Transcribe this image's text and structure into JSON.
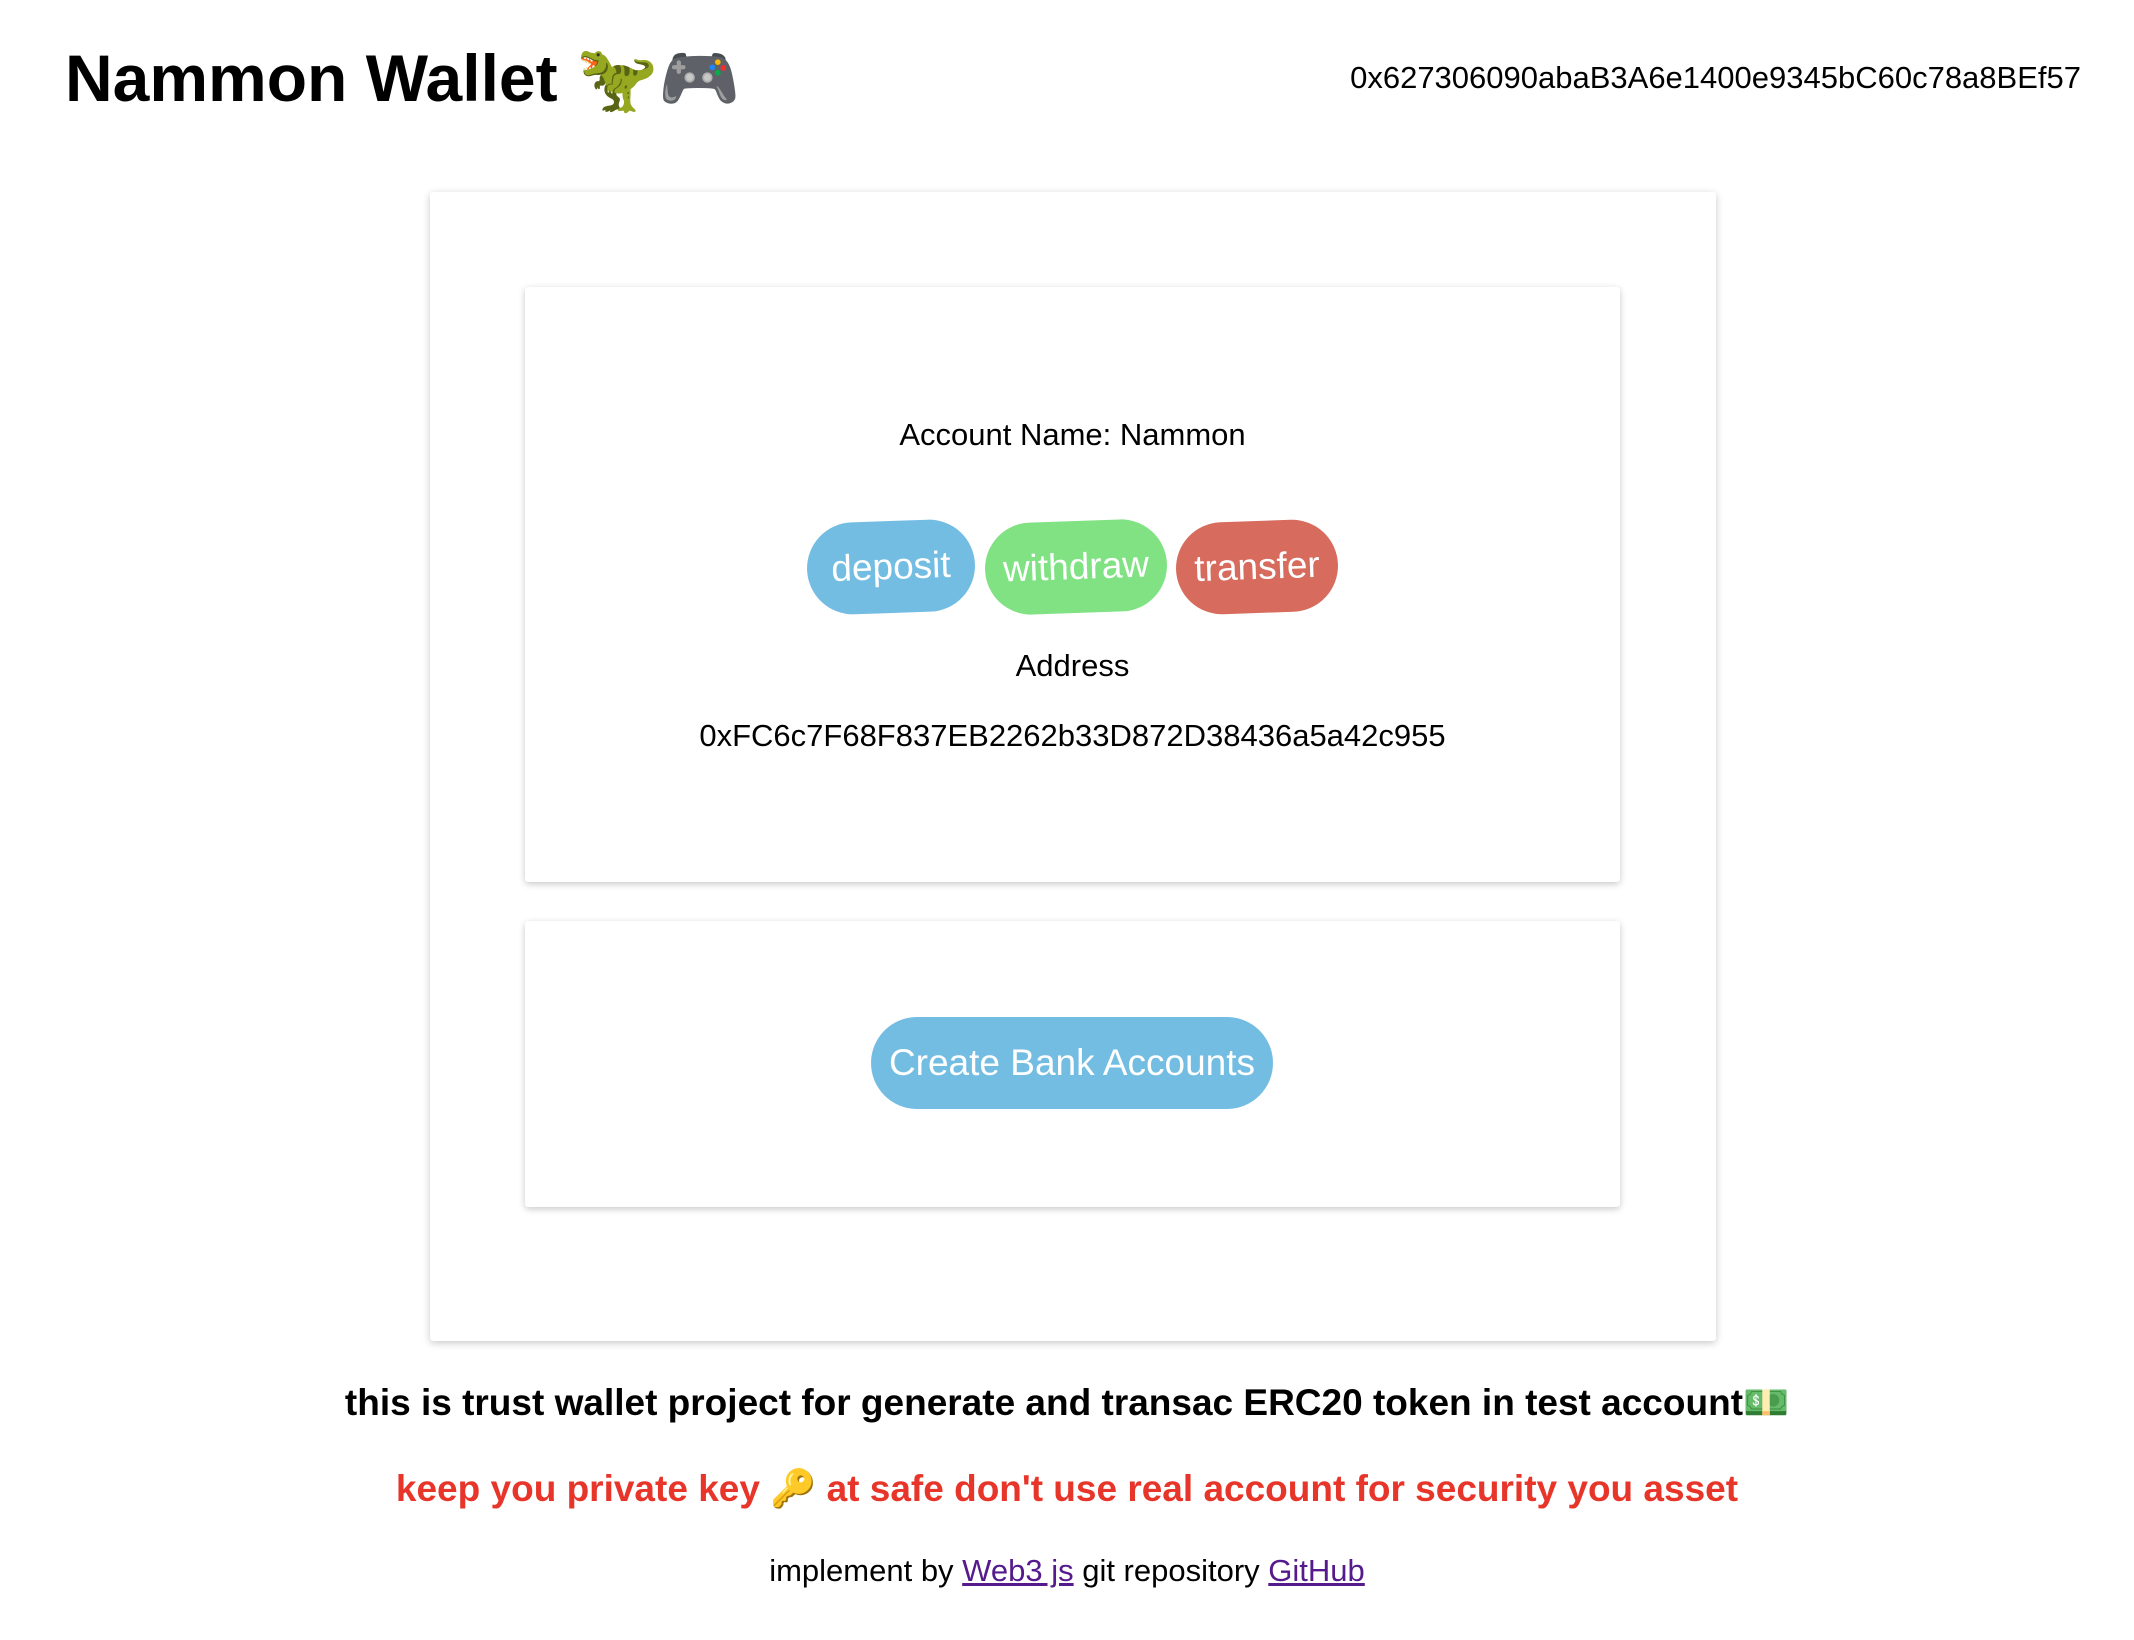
{
  "header": {
    "title": "Nammon Wallet",
    "title_emoji": "🦖🎮",
    "wallet_address": "0x627306090abaB3A6e1400e9345bC60c78a8BEf57"
  },
  "account_card": {
    "account_name": "Account Name: Nammon",
    "buttons": {
      "deposit": "deposit",
      "withdraw": "withdraw",
      "transfer": "transfer"
    },
    "address_label": "Address",
    "address_value": "0xFC6c7F68F837EB2262b33D872D38436a5a42c955"
  },
  "create_card": {
    "create_label": "Create Bank Accounts"
  },
  "footer": {
    "description": "this is trust wallet project for generate and transac ERC20 token in test account💵",
    "warning_before": "keep you private key ",
    "warning_emoji": "🔑",
    "warning_after": " at safe don't use real account for security you asset",
    "implement_prefix": "implement by ",
    "web3_link": "Web3 js",
    "repo_prefix": " git repository ",
    "github_link": "GitHub"
  },
  "colors": {
    "deposit": "#74bde2",
    "withdraw": "#80e283",
    "transfer": "#d76b5d",
    "warning": "#e8352a",
    "link": "#551a8b"
  }
}
